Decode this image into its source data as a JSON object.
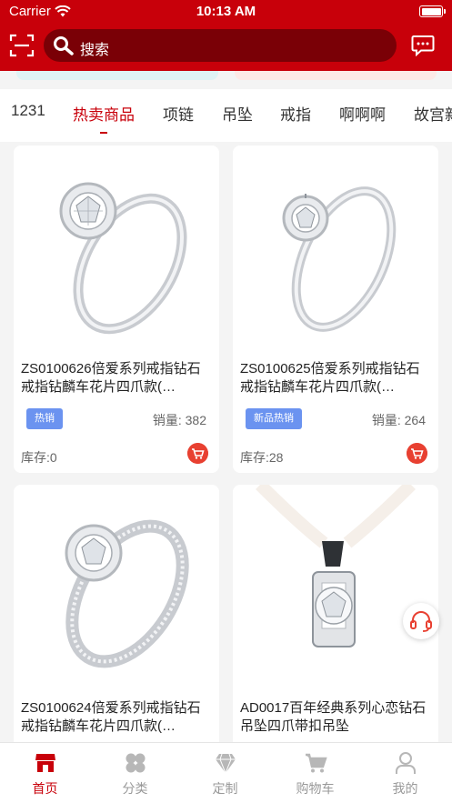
{
  "status_bar": {
    "carrier": "Carrier",
    "time": "10:13 AM"
  },
  "header": {
    "search_placeholder": "搜索",
    "accent_color": "#c8000a"
  },
  "tabs": [
    {
      "label": "1231",
      "active": false
    },
    {
      "label": "热卖商品",
      "active": true
    },
    {
      "label": "项链",
      "active": false
    },
    {
      "label": "吊坠",
      "active": false
    },
    {
      "label": "戒指",
      "active": false
    },
    {
      "label": "啊啊啊",
      "active": false
    },
    {
      "label": "故宫新",
      "active": false
    }
  ],
  "products": [
    {
      "title": "ZS0100626倍爱系列戒指钻石戒指钻麟车花片四爪款(…",
      "tag": "热销",
      "sales": "销量: 382",
      "stock": "库存:0"
    },
    {
      "title": "ZS0100625倍爱系列戒指钻石戒指钻麟车花片四爪款(…",
      "tag": "新品热销",
      "sales": "销量: 264",
      "stock": "库存:28"
    },
    {
      "title": "ZS0100624倍爱系列戒指钻石戒指钻麟车花片四爪款(…"
    },
    {
      "title": "AD0017百年经典系列心恋钻石吊坠四爪带扣吊坠"
    }
  ],
  "bottom_nav": [
    {
      "label": "首页",
      "icon": "store-icon",
      "active": true
    },
    {
      "label": "分类",
      "icon": "category-icon",
      "active": false
    },
    {
      "label": "定制",
      "icon": "diamond-icon",
      "active": false
    },
    {
      "label": "购物车",
      "icon": "cart-icon",
      "active": false
    },
    {
      "label": "我的",
      "icon": "user-icon",
      "active": false
    }
  ]
}
